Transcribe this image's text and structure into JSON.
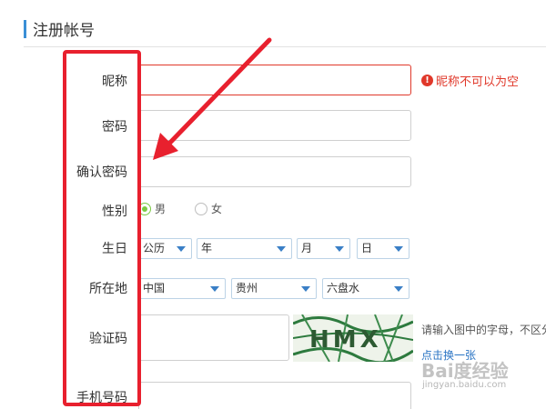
{
  "header": {
    "title": "注册帐号"
  },
  "form": {
    "nickname": {
      "label": "昵称",
      "value": "",
      "error": "昵称不可以为空",
      "error_icon": "!"
    },
    "password": {
      "label": "密码",
      "value": ""
    },
    "confirm_password": {
      "label": "确认密码",
      "value": ""
    },
    "gender": {
      "label": "性别",
      "options": [
        "男",
        "女"
      ],
      "selected": "男"
    },
    "birthday": {
      "label": "生日",
      "calendar": "公历",
      "year": "年",
      "month": "月",
      "day": "日"
    },
    "location": {
      "label": "所在地",
      "country": "中国",
      "province": "贵州",
      "city": "六盘水"
    },
    "captcha": {
      "label": "验证码",
      "value": "",
      "hint": "请输入图中的字母，不区分",
      "refresh": "点击换一张",
      "image_text": "HMX"
    },
    "phone": {
      "label": "手机号码",
      "value": ""
    }
  },
  "watermark": {
    "main": "Bai度经验",
    "sub": "jingyan.baidu.com"
  },
  "colors": {
    "accent": "#3a8fd6",
    "error": "#e0382a",
    "annotation": "#e8202e",
    "radio_checked": "#7ac943",
    "link": "#2a74c4"
  }
}
